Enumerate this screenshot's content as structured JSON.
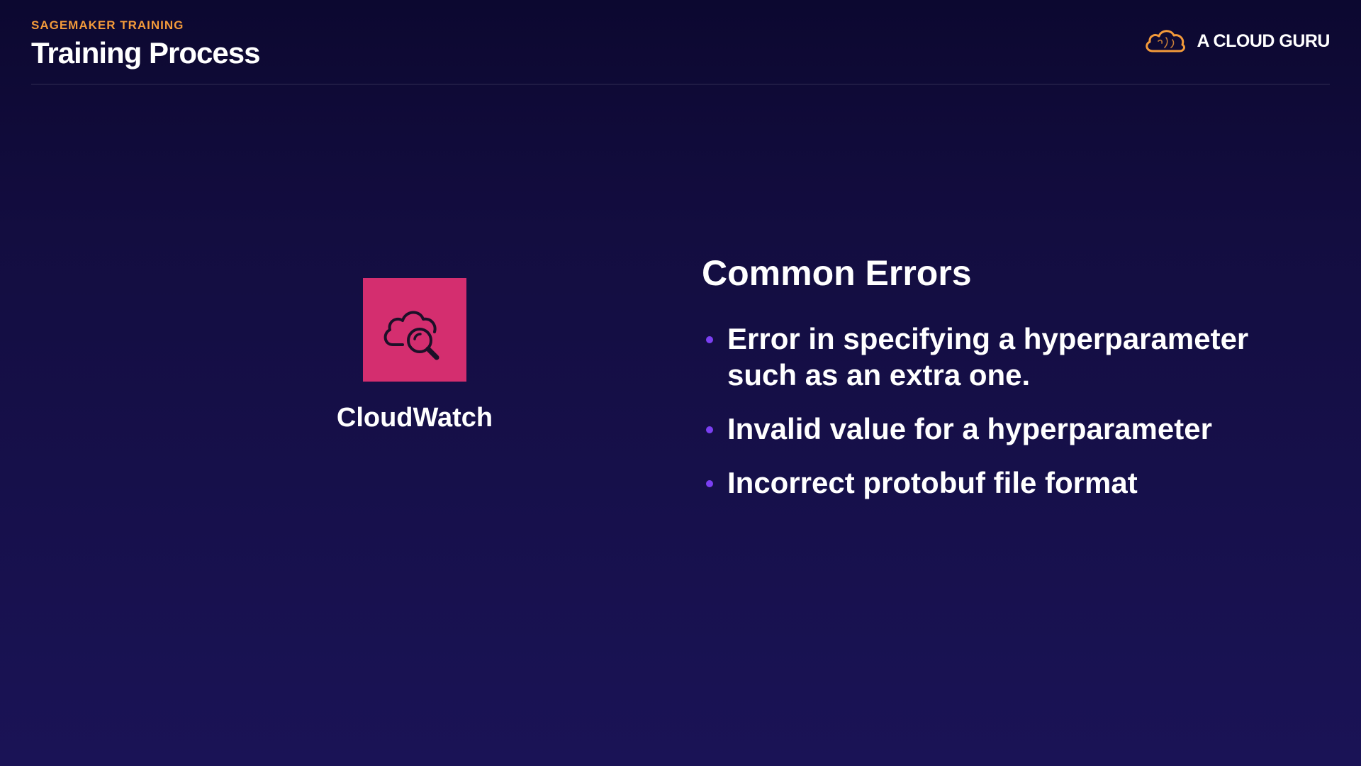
{
  "header": {
    "section_label": "SAGEMAKER TRAINING",
    "title": "Training Process"
  },
  "brand": {
    "name": "A CLOUD GURU",
    "logo_icon": "cloud-logo-icon",
    "logo_color": "#f39a3a"
  },
  "service": {
    "name": "CloudWatch",
    "icon": "cloud-magnifier-icon",
    "tile_color": "#d42e6f"
  },
  "content": {
    "title": "Common Errors",
    "bullets": [
      "Error in specifying a hyperparameter such as an extra one.",
      "Invalid value for a hyperparameter",
      "Incorrect protobuf file format"
    ],
    "bullet_color": "#7b3ff2"
  },
  "colors": {
    "background_top": "#0c0830",
    "background_bottom": "#1a1356",
    "accent_orange": "#f39a3a"
  }
}
